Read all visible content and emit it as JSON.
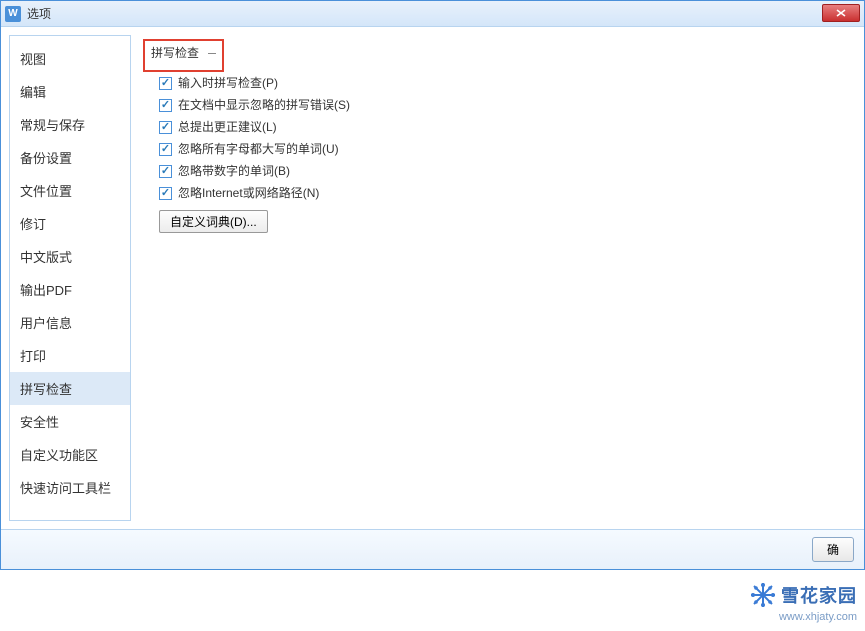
{
  "title": "选项",
  "close_label": "×",
  "sidebar": {
    "items": [
      {
        "label": "视图",
        "selected": false
      },
      {
        "label": "编辑",
        "selected": false
      },
      {
        "label": "常规与保存",
        "selected": false
      },
      {
        "label": "备份设置",
        "selected": false
      },
      {
        "label": "文件位置",
        "selected": false
      },
      {
        "label": "修订",
        "selected": false
      },
      {
        "label": "中文版式",
        "selected": false
      },
      {
        "label": "输出PDF",
        "selected": false
      },
      {
        "label": "用户信息",
        "selected": false
      },
      {
        "label": "打印",
        "selected": false
      },
      {
        "label": "拼写检查",
        "selected": true
      },
      {
        "label": "安全性",
        "selected": false
      },
      {
        "label": "自定义功能区",
        "selected": false
      },
      {
        "label": "快速访问工具栏",
        "selected": false
      }
    ]
  },
  "content": {
    "section_title": "拼写检查",
    "checks": [
      {
        "label": "输入时拼写检查(P)",
        "checked": true
      },
      {
        "label": "在文档中显示忽略的拼写错误(S)",
        "checked": true
      },
      {
        "label": "总提出更正建议(L)",
        "checked": true
      },
      {
        "label": "忽略所有字母都大写的单词(U)",
        "checked": true
      },
      {
        "label": "忽略带数字的单词(B)",
        "checked": true
      },
      {
        "label": "忽略Internet或网络路径(N)",
        "checked": true
      }
    ],
    "custom_dict_label": "自定义词典(D)..."
  },
  "footer": {
    "ok_label": "确"
  },
  "watermark": {
    "main": "雪花家园",
    "sub": "www.xhjaty.com"
  }
}
